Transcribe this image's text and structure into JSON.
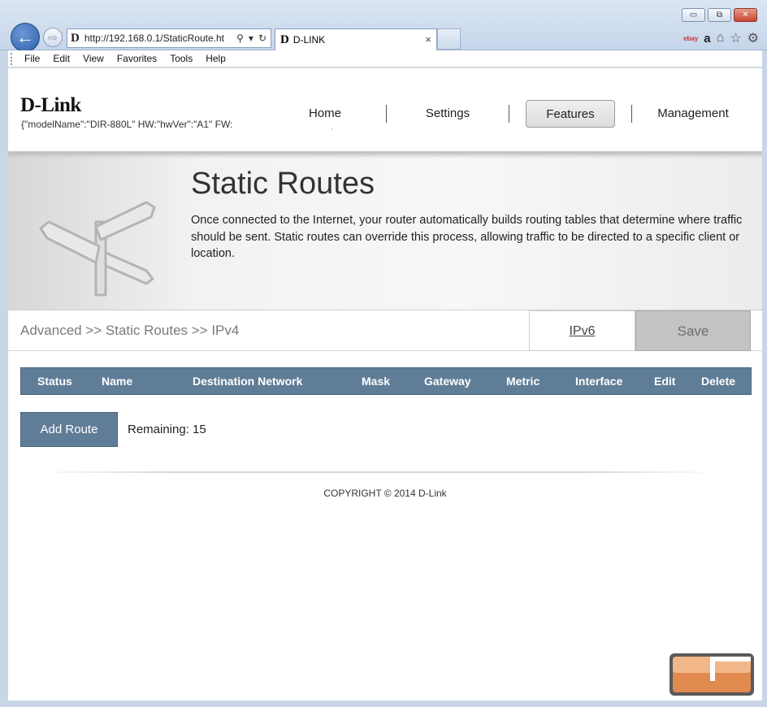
{
  "browser": {
    "window_buttons": {
      "minimize": "▭",
      "restore": "⧉",
      "close": "✕"
    },
    "address_url": "http://192.168.0.1/StaticRoute.ht",
    "tab_title": "D-LINK",
    "tab_close": "×",
    "favicon_letter": "D",
    "menu": [
      "File",
      "Edit",
      "View",
      "Favorites",
      "Tools",
      "Help"
    ]
  },
  "header": {
    "logo": "D-Link",
    "model_info": "{\"modelName\":\"DIR-880L\"    HW:\"hwVer\":\"A1\"    FW:",
    "stray_mark": "ˌ",
    "nav": [
      "Home",
      "Settings",
      "Features",
      "Management"
    ],
    "active_nav": "Features"
  },
  "hero": {
    "title": "Static Routes",
    "description": "Once connected to the Internet, your router automatically builds routing tables that determine where traffic should be sent. Static routes can override this process, allowing traffic to be directed to a specific client or location."
  },
  "breadcrumb": "Advanced >> Static Routes >> IPv4",
  "ipv6_link": "IPv6",
  "save_label": "Save",
  "table": {
    "columns": [
      "Status",
      "Name",
      "Destination Network",
      "Mask",
      "Gateway",
      "Metric",
      "Interface",
      "Edit",
      "Delete"
    ],
    "rows": []
  },
  "add_route_label": "Add Route",
  "remaining_text": "Remaining: 15",
  "copyright": "COPYRIGHT © 2014 D-Link",
  "colors": {
    "accent": "#607d97",
    "save_disabled": "#c3c3c3"
  }
}
